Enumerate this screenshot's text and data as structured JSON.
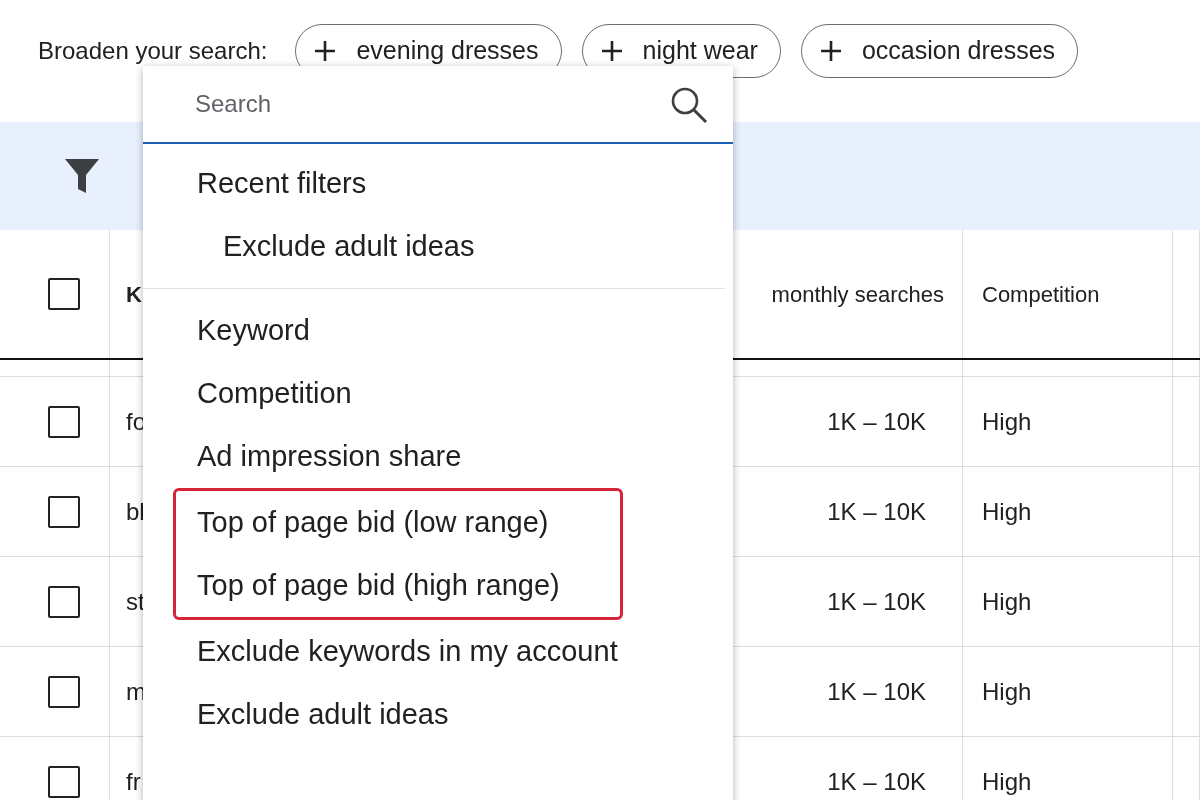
{
  "broaden": {
    "label": "Broaden your search:",
    "chips": [
      {
        "label": "evening dresses"
      },
      {
        "label": "night wear"
      },
      {
        "label": "occasion dresses"
      }
    ]
  },
  "table": {
    "select_all": {
      "checked": false
    },
    "columns": [
      {
        "label": "K"
      },
      {
        "label": "monthly searches"
      },
      {
        "label": "Competition"
      }
    ],
    "rows": [
      {
        "checked": false,
        "keyword": "fo",
        "searches": "1K – 10K",
        "competition": "High"
      },
      {
        "checked": false,
        "keyword": "bl",
        "searches": "1K – 10K",
        "competition": "High"
      },
      {
        "checked": false,
        "keyword": "st",
        "searches": "1K – 10K",
        "competition": "High"
      },
      {
        "checked": false,
        "keyword": "m",
        "searches": "1K – 10K",
        "competition": "High"
      },
      {
        "checked": false,
        "keyword": "fr",
        "searches": "1K – 10K",
        "competition": "High"
      }
    ]
  },
  "filter_menu": {
    "search": {
      "placeholder": "Search"
    },
    "recent": {
      "title": "Recent filters",
      "items": [
        {
          "label": "Exclude adult ideas"
        }
      ]
    },
    "items": [
      {
        "label": "Keyword",
        "highlighted": false
      },
      {
        "label": "Competition",
        "highlighted": false
      },
      {
        "label": "Ad impression share",
        "highlighted": false
      },
      {
        "label": "Top of page bid (low range)",
        "highlighted": true
      },
      {
        "label": "Top of page bid (high range)",
        "highlighted": true
      },
      {
        "label": "Exclude keywords in my account",
        "highlighted": false
      },
      {
        "label": "Exclude adult ideas",
        "highlighted": false
      }
    ]
  }
}
